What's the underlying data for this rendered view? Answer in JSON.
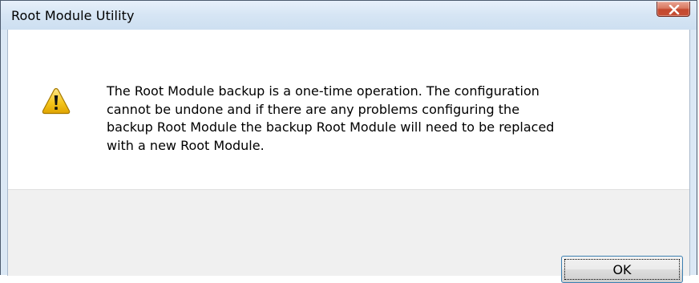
{
  "window": {
    "title": "Root Module Utility",
    "close_icon": "close-icon"
  },
  "dialog": {
    "icon": "warning-icon",
    "message": "The Root Module backup is a one-time operation.  The configuration\ncannot be undone and if there are any problems configuring the\nbackup Root Module the backup Root Module will need to be replaced\nwith a new Root Module.",
    "ok_label": "OK"
  },
  "colors": {
    "titlebar": "#d6e5f4",
    "close_button": "#c74f35",
    "warning_yellow": "#f5c61d",
    "footer": "#f0f0f0",
    "button_border": "#3c7fb1"
  }
}
